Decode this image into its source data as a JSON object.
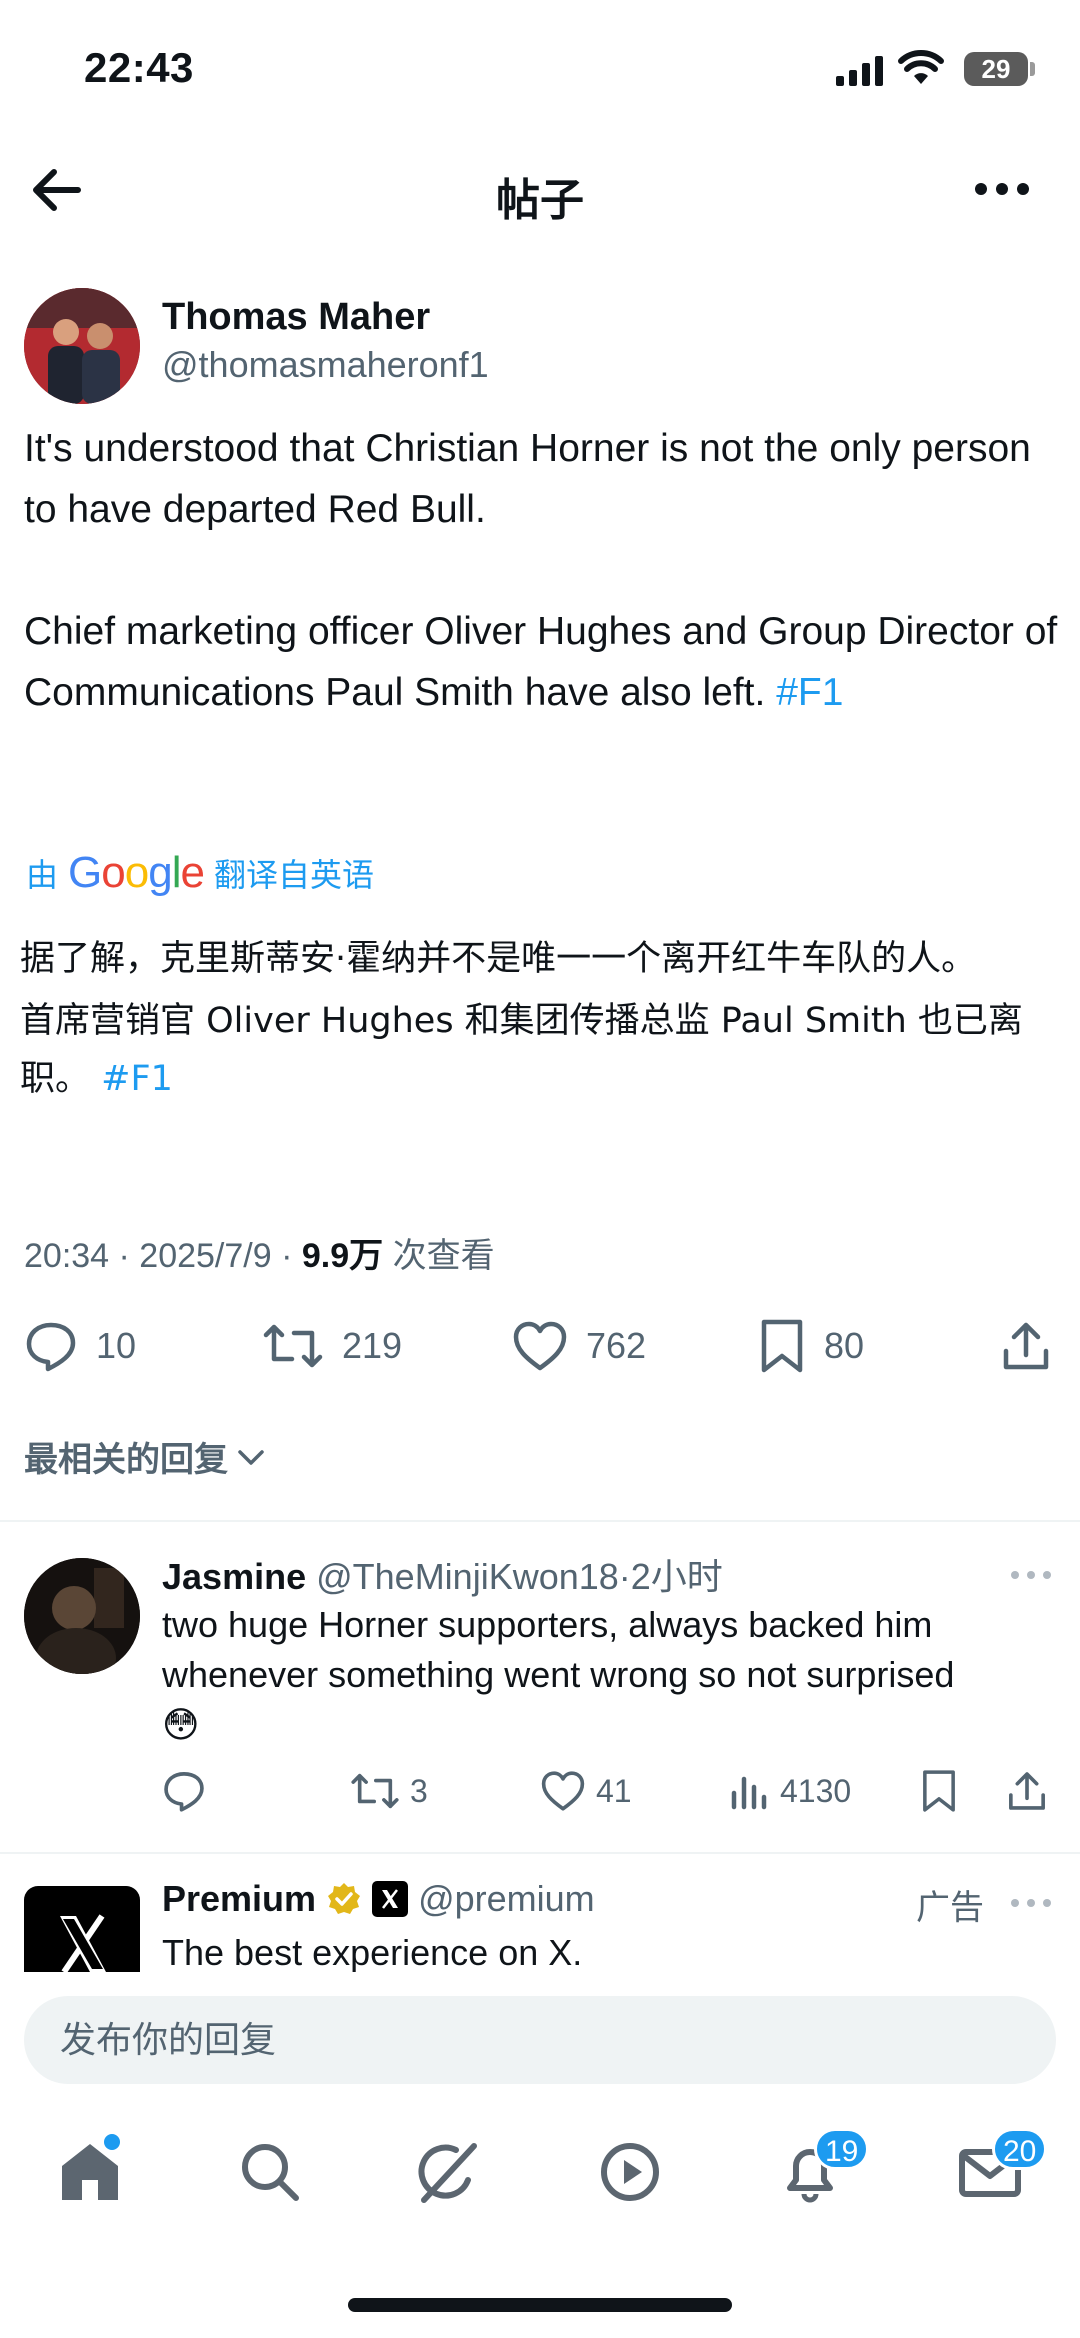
{
  "status_bar": {
    "time": "22:43",
    "battery": "29"
  },
  "header": {
    "title": "帖子"
  },
  "post": {
    "author_name": "Thomas Maher",
    "author_handle": "@thomasmaheronf1",
    "text_line1": "It's understood that Christian Horner is not the only person to have departed Red Bull.",
    "text_line2": "Chief marketing officer Oliver Hughes and Group Director of Communications Paul Smith have also left.",
    "hashtag": "#F1",
    "translated_by_prefix": "由",
    "translated_by_brand": "Google",
    "translated_by_suffix": "翻译自英语",
    "translation_line1": "据了解，克里斯蒂安·霍纳并不是唯一一个离开红牛车队的人。",
    "translation_line2": "首席营销官 Oliver Hughes 和集团传播总监 Paul Smith 也已离职。",
    "meta_time": "20:34 · 2025/7/9 · ",
    "meta_views": "9.9万",
    "meta_views_suffix": " 次查看",
    "replies": "10",
    "reposts": "219",
    "likes": "762",
    "bookmarks": "80"
  },
  "sort": {
    "label": "最相关的回复"
  },
  "reply": {
    "name": "Jasmine",
    "handle": "@TheMinjiKwon18",
    "time": "·2小时",
    "text": "two huge Horner supporters, always backed him whenever something went wrong so not surprised",
    "emoji": "😳",
    "replies": "",
    "reposts": "3",
    "likes": "41",
    "views": "4130"
  },
  "ad": {
    "name": "Premium",
    "handle": "@premium",
    "label": "广告",
    "text": "The best experience on X."
  },
  "composer": {
    "placeholder": "发布你的回复"
  },
  "nav": {
    "notifications_badge": "19",
    "messages_badge": "20"
  },
  "colors": {
    "accent": "#1d9bf0",
    "muted": "#536471",
    "text": "#0f1419",
    "verified_gold": "#e2b719"
  }
}
